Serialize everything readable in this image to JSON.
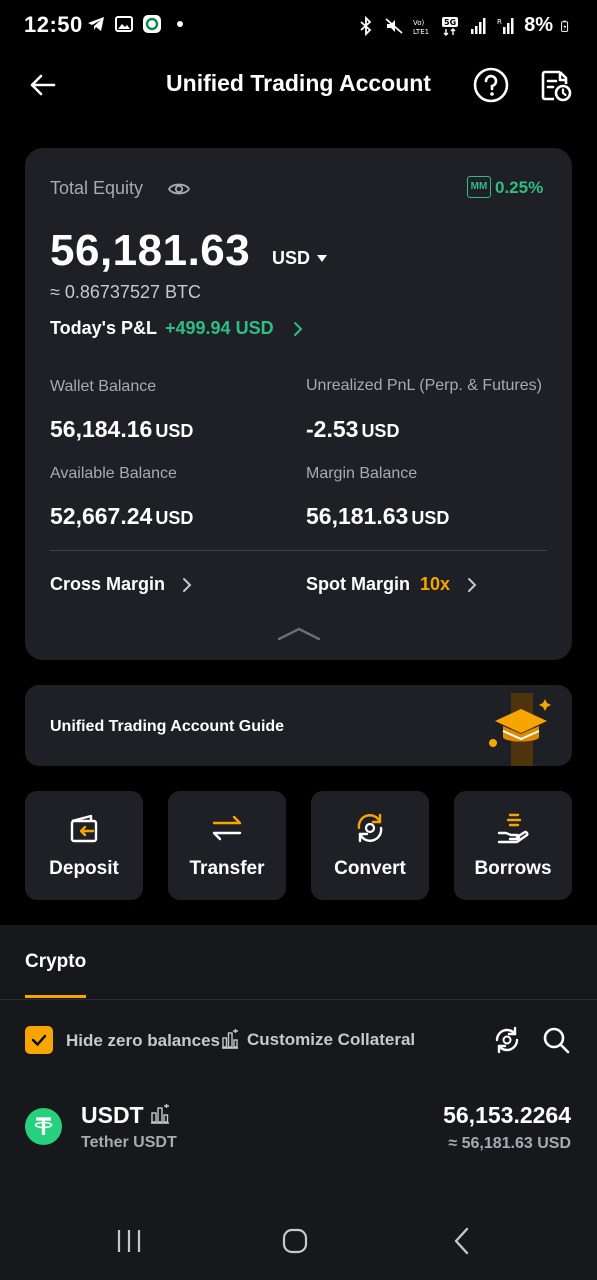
{
  "status_bar": {
    "time": "12:50",
    "battery": "8%",
    "icons": [
      "telegram-icon",
      "gallery-icon",
      "app-icon",
      "dot-icon",
      "bluetooth-icon",
      "mute-icon",
      "volte-icon",
      "5g-icon",
      "signal-icon",
      "signal-r-icon",
      "battery-icon"
    ]
  },
  "header": {
    "title": "Unified Trading Account"
  },
  "equity_card": {
    "total_equity_label": "Total Equity",
    "mm_badge": "MM",
    "mm_value": "0.25%",
    "equity_value": "56,181.63",
    "equity_unit": "USD",
    "btc_equivalent": "≈ 0.86737527 BTC",
    "pnl_label": "Today's P&L",
    "pnl_value": "+499.94 USD",
    "stats": [
      {
        "label": "Wallet Balance",
        "value": "56,184.16",
        "unit": "USD"
      },
      {
        "label": "Unrealized PnL (Perp. & Futures)",
        "value": "-2.53",
        "unit": "USD"
      },
      {
        "label": "Available Balance",
        "value": "52,667.24",
        "unit": "USD"
      },
      {
        "label": "Margin Balance",
        "value": "56,181.63",
        "unit": "USD"
      }
    ],
    "cross_margin": "Cross Margin",
    "spot_margin": "Spot Margin",
    "spot_leverage": "10x"
  },
  "guide": {
    "text": "Unified Trading Account Guide"
  },
  "actions": [
    {
      "label": "Deposit",
      "icon": "deposit-icon"
    },
    {
      "label": "Transfer",
      "icon": "transfer-icon"
    },
    {
      "label": "Convert",
      "icon": "convert-icon"
    },
    {
      "label": "Borrows",
      "icon": "borrows-icon"
    }
  ],
  "assets_section": {
    "tab": "Crypto",
    "hide_zero": "Hide zero balances",
    "customize_collateral": "Customize Collateral",
    "assets": [
      {
        "symbol": "USDT",
        "name": "Tether USDT",
        "amount": "56,153.2264",
        "usd_value": "≈ 56,181.63 USD"
      }
    ]
  },
  "colors": {
    "background": "#000000",
    "card": "#1e2026",
    "accent": "#f7a600",
    "positive": "#2ebd85",
    "muted_text": "#a7aab0"
  }
}
